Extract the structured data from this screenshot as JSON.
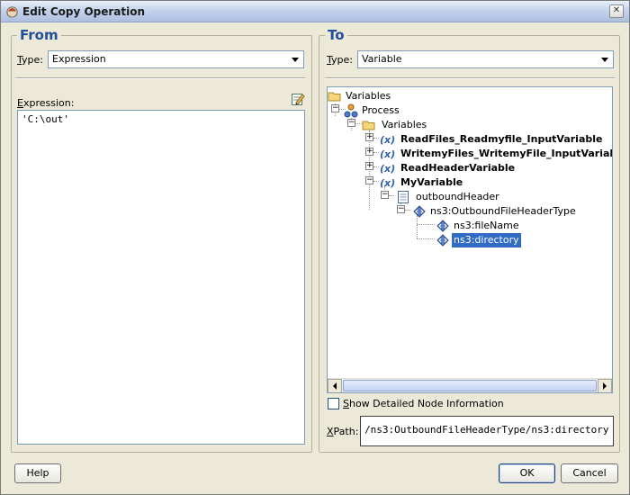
{
  "window": {
    "title": "Edit Copy Operation",
    "close_glyph": "✕"
  },
  "from": {
    "legend": "From",
    "type_label_u": "T",
    "type_label_rest": "ype:",
    "type_value": "Expression",
    "expression_label_u": "E",
    "expression_label_rest": "xpression:",
    "expression_value": "'C:\\out'",
    "edit_icon": "edit-expression-icon"
  },
  "to": {
    "legend": "To",
    "type_label_u": "T",
    "type_label_rest": "ype:",
    "type_value": "Variable",
    "tree": {
      "nodes": [
        {
          "label": "Variables",
          "icon": "folder-icon"
        },
        {
          "label": "Process",
          "icon": "process-icon"
        },
        {
          "label": "Variables",
          "icon": "folder-icon"
        },
        {
          "label": "ReadFiles_Readmyfile_InputVariable",
          "icon": "variable-icon",
          "expander": "+"
        },
        {
          "label": "WritemyFiles_WritemyFile_InputVariable",
          "icon": "variable-icon",
          "expander": "+"
        },
        {
          "label": "ReadHeaderVariable",
          "icon": "variable-icon",
          "expander": "+"
        },
        {
          "label": "MyVariable",
          "icon": "variable-icon",
          "expander": "−"
        },
        {
          "label": "outboundHeader",
          "icon": "document-icon",
          "expander": "−"
        },
        {
          "label": "ns3:OutboundFileHeaderType",
          "icon": "element-icon",
          "expander": "−"
        },
        {
          "label": "ns3:fileName",
          "icon": "element-icon"
        },
        {
          "label": "ns3:directory",
          "icon": "element-icon",
          "selected": true
        }
      ],
      "expanders": {
        "process": "−",
        "variables": "−"
      }
    },
    "show_detailed_label_u": "S",
    "show_detailed_label_rest": "how Detailed Node Information",
    "show_detailed_checked": false,
    "xpath_label_u": "X",
    "xpath_label_rest": "Path:",
    "xpath_value": "/ns3:OutboundFileHeaderType/ns3:directory"
  },
  "buttons": {
    "help": "Help",
    "ok": "OK",
    "cancel": "Cancel"
  }
}
